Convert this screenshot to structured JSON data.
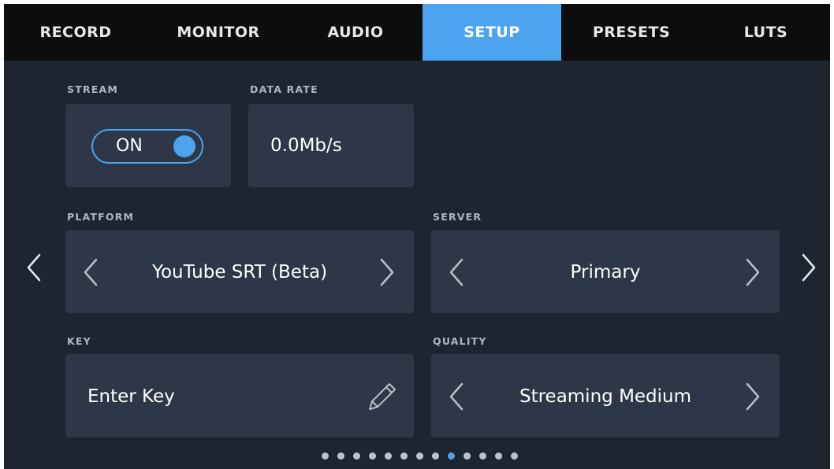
{
  "tabs": [
    {
      "label": "RECORD"
    },
    {
      "label": "MONITOR"
    },
    {
      "label": "AUDIO"
    },
    {
      "label": "SETUP"
    },
    {
      "label": "PRESETS"
    },
    {
      "label": "LUTS"
    }
  ],
  "active_tab": "SETUP",
  "stream": {
    "label": "STREAM",
    "toggle_text": "ON",
    "enabled": true
  },
  "data_rate": {
    "label": "DATA RATE",
    "value": "0.0Mb/s"
  },
  "platform": {
    "label": "PLATFORM",
    "value": "YouTube SRT (Beta)"
  },
  "server": {
    "label": "SERVER",
    "value": "Primary"
  },
  "key": {
    "label": "KEY",
    "value": "Enter Key"
  },
  "quality": {
    "label": "QUALITY",
    "value": "Streaming Medium"
  },
  "pagination": {
    "total": 13,
    "active_index": 8
  },
  "colors": {
    "accent": "#4da3ee",
    "background": "#1e2530",
    "panel": "#2e3747",
    "tabbar": "#0d0d0d"
  },
  "icons": [
    "chevron-left-icon",
    "chevron-right-icon",
    "pencil-icon"
  ]
}
